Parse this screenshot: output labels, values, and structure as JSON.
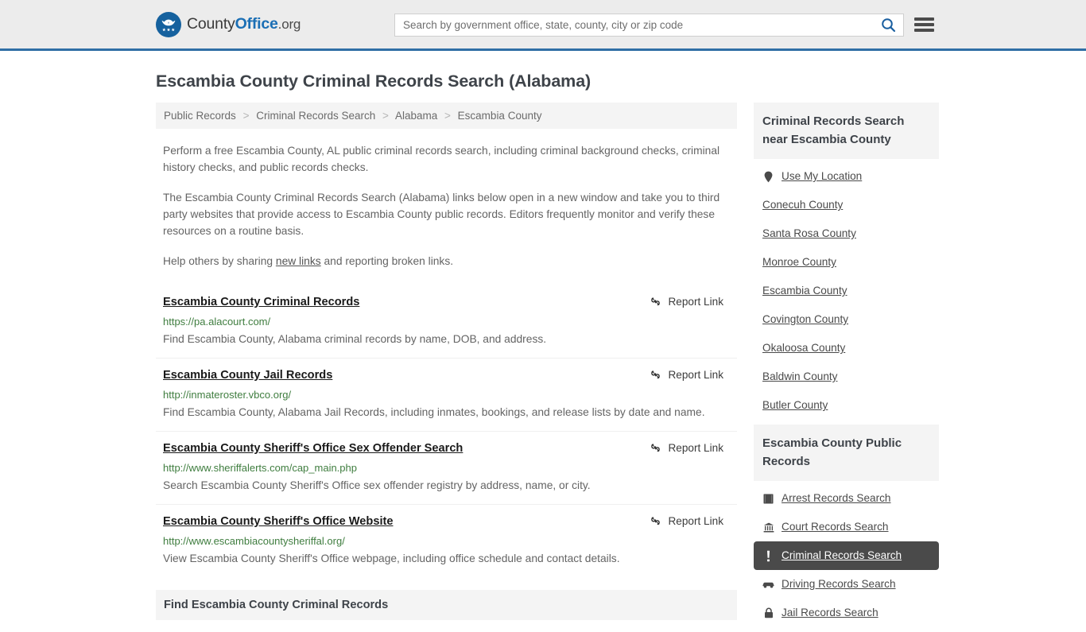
{
  "header": {
    "brand": {
      "part1": "County",
      "part2": "Office",
      "tld": ".org"
    },
    "search": {
      "placeholder": "Search by government office, state, county, city or zip code",
      "value": ""
    },
    "search_icon": "search-icon",
    "menu_icon": "hamburger-menu-icon"
  },
  "page": {
    "title": "Escambia County Criminal Records Search (Alabama)"
  },
  "breadcrumb": {
    "items": [
      "Public Records",
      "Criminal Records Search",
      "Alabama",
      "Escambia County"
    ],
    "separator": ">"
  },
  "intro": {
    "p1": "Perform a free Escambia County, AL public criminal records search, including criminal background checks, criminal history checks, and public records checks.",
    "p2": "The Escambia County Criminal Records Search (Alabama) links below open in a new window and take you to third party websites that provide access to Escambia County public records. Editors frequently monitor and verify these resources on a routine basis.",
    "p3_before": "Help others by sharing ",
    "p3_link": "new links",
    "p3_after": " and reporting broken links."
  },
  "results": {
    "report_label": "Report Link",
    "report_icon": "broken-link-icon",
    "items": [
      {
        "title": "Escambia County Criminal Records",
        "url": "https://pa.alacourt.com/",
        "desc": "Find Escambia County, Alabama criminal records by name, DOB, and address."
      },
      {
        "title": "Escambia County Jail Records",
        "url": "http://inmateroster.vbco.org/",
        "desc": "Find Escambia County, Alabama Jail Records, including inmates, bookings, and release lists by date and name."
      },
      {
        "title": "Escambia County Sheriff's Office Sex Offender Search",
        "url": "http://www.sheriffalerts.com/cap_main.php",
        "desc": "Search Escambia County Sheriff's Office sex offender registry by address, name, or city."
      },
      {
        "title": "Escambia County Sheriff's Office Website",
        "url": "http://www.escambiacountysheriffal.org/",
        "desc": "View Escambia County Sheriff's Office webpage, including office schedule and contact details."
      }
    ]
  },
  "bottom_section": {
    "heading": "Find Escambia County Criminal Records"
  },
  "sidebar": {
    "nearby": {
      "heading": "Criminal Records Search near Escambia County",
      "items": [
        {
          "label": "Use My Location",
          "icon": "map-pin-icon"
        },
        {
          "label": "Conecuh County",
          "icon": ""
        },
        {
          "label": "Santa Rosa County",
          "icon": ""
        },
        {
          "label": "Monroe County",
          "icon": ""
        },
        {
          "label": "Escambia County",
          "icon": ""
        },
        {
          "label": "Covington County",
          "icon": ""
        },
        {
          "label": "Okaloosa County",
          "icon": ""
        },
        {
          "label": "Baldwin County",
          "icon": ""
        },
        {
          "label": "Butler County",
          "icon": ""
        }
      ]
    },
    "public_records": {
      "heading": "Escambia County Public Records",
      "items": [
        {
          "label": "Arrest Records Search",
          "icon": "fingerprint-card-icon",
          "active": false
        },
        {
          "label": "Court Records Search",
          "icon": "courthouse-icon",
          "active": false
        },
        {
          "label": "Criminal Records Search",
          "icon": "exclamation-icon",
          "active": true
        },
        {
          "label": "Driving Records Search",
          "icon": "car-icon",
          "active": false
        },
        {
          "label": "Jail Records Search",
          "icon": "lock-icon",
          "active": false
        }
      ]
    }
  },
  "colors": {
    "header_bg": "#ececec",
    "header_border": "#2f6ea5",
    "brand_blue": "#1b6fb5",
    "link_green": "#3f7d3f",
    "panel_bg": "#f4f4f4",
    "active_bg": "#4a4a4a"
  }
}
